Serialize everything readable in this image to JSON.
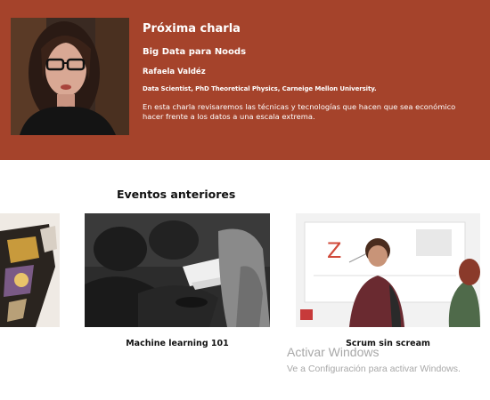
{
  "next_talk": {
    "heading": "Próxima charla",
    "title": "Big Data para Noods",
    "speaker_name": "Rafaela Valdéz",
    "speaker_bio": "Data Scientist, PhD Theoretical Physics, Carneige Mellon University.",
    "description": "En esta charla revisaremos las técnicas y tecnologías que hacen que sea económico hacer frente a los datos a una escala extrema.",
    "banner_color": "#a5432b"
  },
  "past_events": {
    "heading": "Eventos anteriores",
    "events": [
      {
        "label": ""
      },
      {
        "label": "Machine learning 101"
      },
      {
        "label": "Scrum sin scream"
      }
    ]
  },
  "activation_notice": {
    "title": "Activar Windows",
    "subtitle": "Ve a Configuración para activar Windows."
  }
}
